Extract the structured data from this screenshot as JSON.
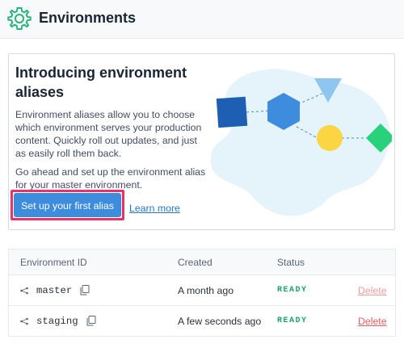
{
  "header": {
    "title": "Environments",
    "icon": "gear-icon"
  },
  "promo": {
    "heading": "Introducing environment aliases",
    "description": "Environment aliases allow you to choose which environment serves your production content. Quickly roll out updates, and just as easily roll them back.",
    "description2": "Go ahead and set up the environment alias for your master environment.",
    "cta_label": "Set up your first alias",
    "learn_more_label": "Learn more"
  },
  "table": {
    "columns": [
      "Environment ID",
      "Created",
      "Status"
    ],
    "rows": [
      {
        "id": "master",
        "created": "A month ago",
        "status": "READY",
        "action": "Delete"
      },
      {
        "id": "staging",
        "created": "A few seconds ago",
        "status": "READY",
        "action": "Delete"
      }
    ]
  },
  "colors": {
    "accent": "#3d8cdd",
    "highlight": "#ea3168",
    "status_ready": "#16a570",
    "delete": "#e95e5e",
    "gear": "#2ab27a"
  }
}
